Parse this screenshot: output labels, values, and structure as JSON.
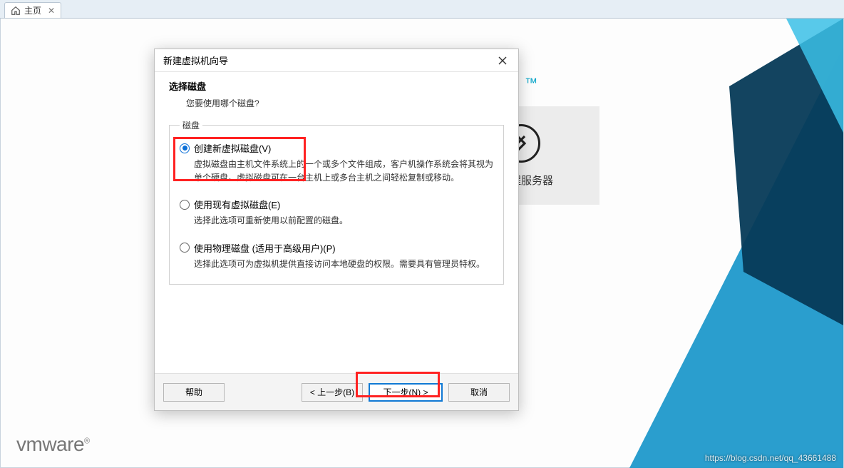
{
  "tab": {
    "label": "主页"
  },
  "background": {
    "tm": "™",
    "remote_label": "接远程服务器"
  },
  "dialog": {
    "title": "新建虚拟机向导",
    "header_title": "选择磁盘",
    "header_sub": "您要使用哪个磁盘?",
    "group_legend": "磁盘",
    "options": [
      {
        "label": "创建新虚拟磁盘(V)",
        "desc": "虚拟磁盘由主机文件系统上的一个或多个文件组成，客户机操作系统会将其视为单个硬盘。虚拟磁盘可在一台主机上或多台主机之间轻松复制或移动。",
        "selected": true
      },
      {
        "label": "使用现有虚拟磁盘(E)",
        "desc": "选择此选项可重新使用以前配置的磁盘。",
        "selected": false
      },
      {
        "label": "使用物理磁盘 (适用于高级用户)(P)",
        "desc": "选择此选项可为虚拟机提供直接访问本地硬盘的权限。需要具有管理员特权。",
        "selected": false
      }
    ],
    "buttons": {
      "help": "帮助",
      "back": "< 上一步(B)",
      "next": "下一步(N) >",
      "cancel": "取消"
    }
  },
  "logo": "vmware",
  "watermark": "https://blog.csdn.net/qq_43661488"
}
